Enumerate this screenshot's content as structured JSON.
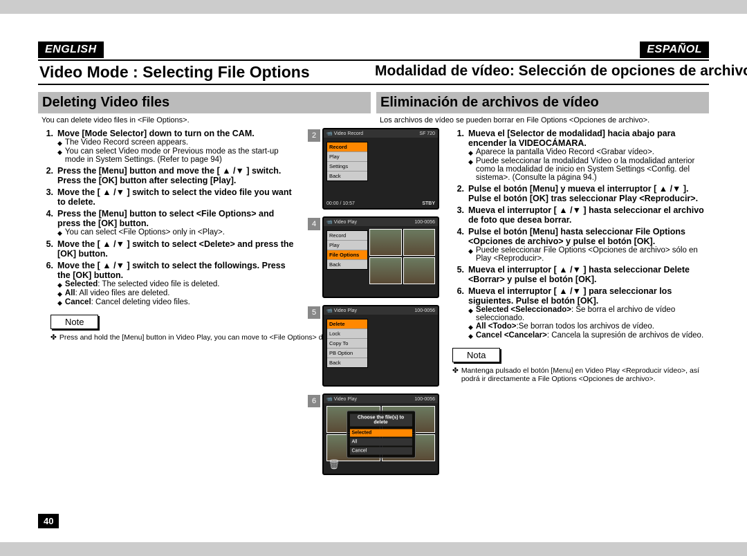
{
  "lang": {
    "en": "ENGLISH",
    "es": "ESPAÑOL"
  },
  "title": {
    "en": "Video Mode : Selecting File Options",
    "es": "Modalidad de vídeo: Selección de opciones de archivo"
  },
  "subheading": {
    "en": "Deleting Video files",
    "es": "Eliminación de archivos de vídeo"
  },
  "intro": {
    "en": "You can delete video files in <File Options>.",
    "es": "Los archivos de vídeo se pueden borrar en File Options <Opciones de archivo>."
  },
  "en_steps": {
    "s1": "Move [Mode Selector] down to turn on the CAM.",
    "s1b1": "The Video Record screen appears.",
    "s1b2": "You can select Video mode or Previous mode as the start-up mode in System Settings. (Refer to page 94)",
    "s2a": "Press the [Menu] button and move the [ ▲ /▼ ] switch.",
    "s2b": "Press the [OK] button after selecting [Play].",
    "s3": "Move the [ ▲ /▼ ] switch to select the video file you want to delete.",
    "s4": "Press the [Menu] button to select <File Options> and press the [OK] button.",
    "s4b1": "You can select <File Options> only in <Play>.",
    "s5": "Move the [ ▲ /▼ ] switch to select <Delete> and press the [OK] button.",
    "s6": "Move the [ ▲ /▼ ] switch to select the followings. Press the [OK] button.",
    "s6b1_label": "Selected",
    "s6b1": ": The selected video file is deleted.",
    "s6b2_label": "All",
    "s6b2": ": All video files are deleted.",
    "s6b3_label": "Cancel",
    "s6b3": ": Cancel deleting video files."
  },
  "es_steps": {
    "s1": "Mueva el [Selector de modalidad] hacia abajo para encender la VIDEOCÁMARA.",
    "s1b1": "Aparece la pantalla Video Record <Grabar vídeo>.",
    "s1b2": "Puede seleccionar la modalidad Vídeo o la modalidad anterior como la modalidad de inicio en System Settings <Config. del sistema>. (Consulte la página 94.)",
    "s2": "Pulse el botón [Menu] y mueva el interruptor [ ▲ /▼ ]. Pulse el botón [OK] tras seleccionar Play <Reproducir>.",
    "s3": "Mueva el interruptor [ ▲ /▼ ] hasta seleccionar el archivo de foto que desea borrar.",
    "s4": "Pulse el botón [Menu] hasta seleccionar File Options <Opciones de archivo> y pulse el botón [OK].",
    "s4b1": "Puede seleccionar File Options <Opciones de archivo> sólo en Play <Reproducir>.",
    "s5": "Mueva el interruptor [ ▲ /▼ ] hasta seleccionar Delete <Borrar> y pulse el botón [OK].",
    "s6": "Mueva el interruptor [ ▲ /▼ ] para seleccionar los siguientes. Pulse el botón [OK].",
    "s6b1_label": "Selected <Seleccionado>",
    "s6b1": ": Se borra el archivo de vídeo seleccionado.",
    "s6b2_label": "All <Todo>",
    "s6b2": ":Se borran todos los archivos de vídeo.",
    "s6b3_label": "Cancel <Cancelar>",
    "s6b3": ": Cancela la supresión de archivos de vídeo."
  },
  "note": {
    "en": "Note",
    "es": "Nota"
  },
  "note_text": {
    "en": "Press and hold the [Menu] button in Video Play, you can move to <File Options> directly.",
    "es": "Mantenga pulsado el botón [Menu] en Video Play <Reproducir vídeo>, así podrá ir directamente a File Options <Opciones de archivo>."
  },
  "pagenum": "40",
  "screens": {
    "nums": [
      "2",
      "4",
      "5",
      "6"
    ],
    "s2": {
      "title": "Video Record",
      "badge": "SF  720",
      "menu": [
        "Record",
        "Play",
        "Settings",
        "Back"
      ],
      "sel": 0,
      "status_l": "00:00 / 10:57",
      "status_r": "STBY"
    },
    "s4": {
      "title": "Video Play",
      "badge": "100-0056",
      "menu": [
        "Record",
        "Play",
        "File Options",
        "Back"
      ],
      "sel": 2
    },
    "s5": {
      "title": "Video Play",
      "badge": "100-0056",
      "menu": [
        "Delete",
        "Lock",
        "Copy To",
        "PB Option",
        "Back"
      ],
      "sel": 0
    },
    "s6": {
      "title": "Video Play",
      "badge": "100-0056",
      "popup_title": "Choose the file(s) to delete",
      "popup": [
        "Selected",
        "All",
        "Cancel"
      ],
      "psel": 0
    }
  }
}
